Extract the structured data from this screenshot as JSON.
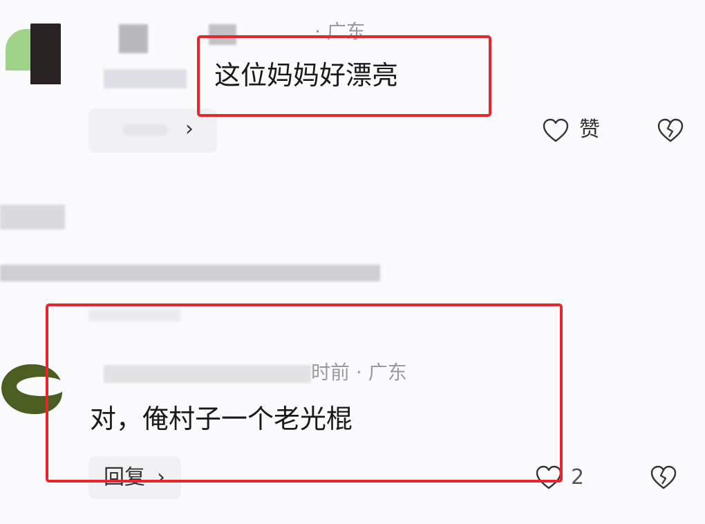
{
  "comment1": {
    "location": "· 广东",
    "text": "这位妈妈好漂亮",
    "like_label": "赞",
    "reply_arrow": "›",
    "icons": {
      "like": "heart-icon",
      "dislike": "broken-heart-icon"
    }
  },
  "comment2": {
    "meta": "时前 · 广东",
    "text": "对，俺村子一个老光棍",
    "reply_label": "回复",
    "reply_arrow": "›",
    "like_count": "2",
    "icons": {
      "like": "heart-icon",
      "dislike": "broken-heart-icon"
    }
  },
  "colors": {
    "highlight": "#e7262b",
    "background": "#fbfbfd",
    "meta_text": "#9a9a9c"
  }
}
